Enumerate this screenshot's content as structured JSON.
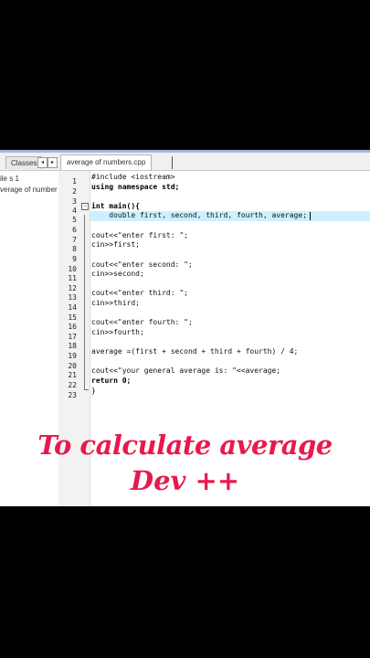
{
  "tabs": {
    "classes_label": "Classes",
    "file_label": "average of numbers.cpp",
    "nav_left": "◂",
    "nav_right": "▸"
  },
  "project": {
    "items": [
      "ile s 1",
      "verage of number"
    ]
  },
  "editor": {
    "line_numbers": [
      "1",
      "2",
      "3",
      "4",
      "5",
      "6",
      "7",
      "8",
      "9",
      "10",
      "11",
      "12",
      "13",
      "14",
      "15",
      "16",
      "17",
      "18",
      "19",
      "20",
      "21",
      "22",
      "23"
    ],
    "lines": [
      {
        "n": 1,
        "text": "#include <iostream>"
      },
      {
        "n": 2,
        "text": "using namespace std;"
      },
      {
        "n": 3,
        "text": ""
      },
      {
        "n": 4,
        "text": "int main(){"
      },
      {
        "n": 5,
        "text": "    double first, second, third, fourth, average;"
      },
      {
        "n": 6,
        "text": ""
      },
      {
        "n": 7,
        "text": "cout<<\"enter first: \";"
      },
      {
        "n": 8,
        "text": "cin>>first;"
      },
      {
        "n": 9,
        "text": ""
      },
      {
        "n": 10,
        "text": "cout<<\"enter second: \";"
      },
      {
        "n": 11,
        "text": "cin>>second;"
      },
      {
        "n": 12,
        "text": ""
      },
      {
        "n": 13,
        "text": "cout<<\"enter third: \";"
      },
      {
        "n": 14,
        "text": "cin>>third;"
      },
      {
        "n": 15,
        "text": ""
      },
      {
        "n": 16,
        "text": "cout<<\"enter fourth: \";"
      },
      {
        "n": 17,
        "text": "cin>>fourth;"
      },
      {
        "n": 18,
        "text": ""
      },
      {
        "n": 19,
        "text": "average =(first + second + third + fourth) / 4;"
      },
      {
        "n": 20,
        "text": ""
      },
      {
        "n": 21,
        "text": "cout<<\"your general average is: \"<<average;"
      },
      {
        "n": 22,
        "text": "return 0;"
      },
      {
        "n": 23,
        "text": "}"
      }
    ],
    "fold_symbol_open": "−",
    "fold_symbol_top": "−"
  },
  "overlay": {
    "line1": "To calculate average",
    "line2": "Dev ++"
  },
  "colors": {
    "overlay_text": "#e8194d",
    "current_line": "#ccf0ff"
  }
}
